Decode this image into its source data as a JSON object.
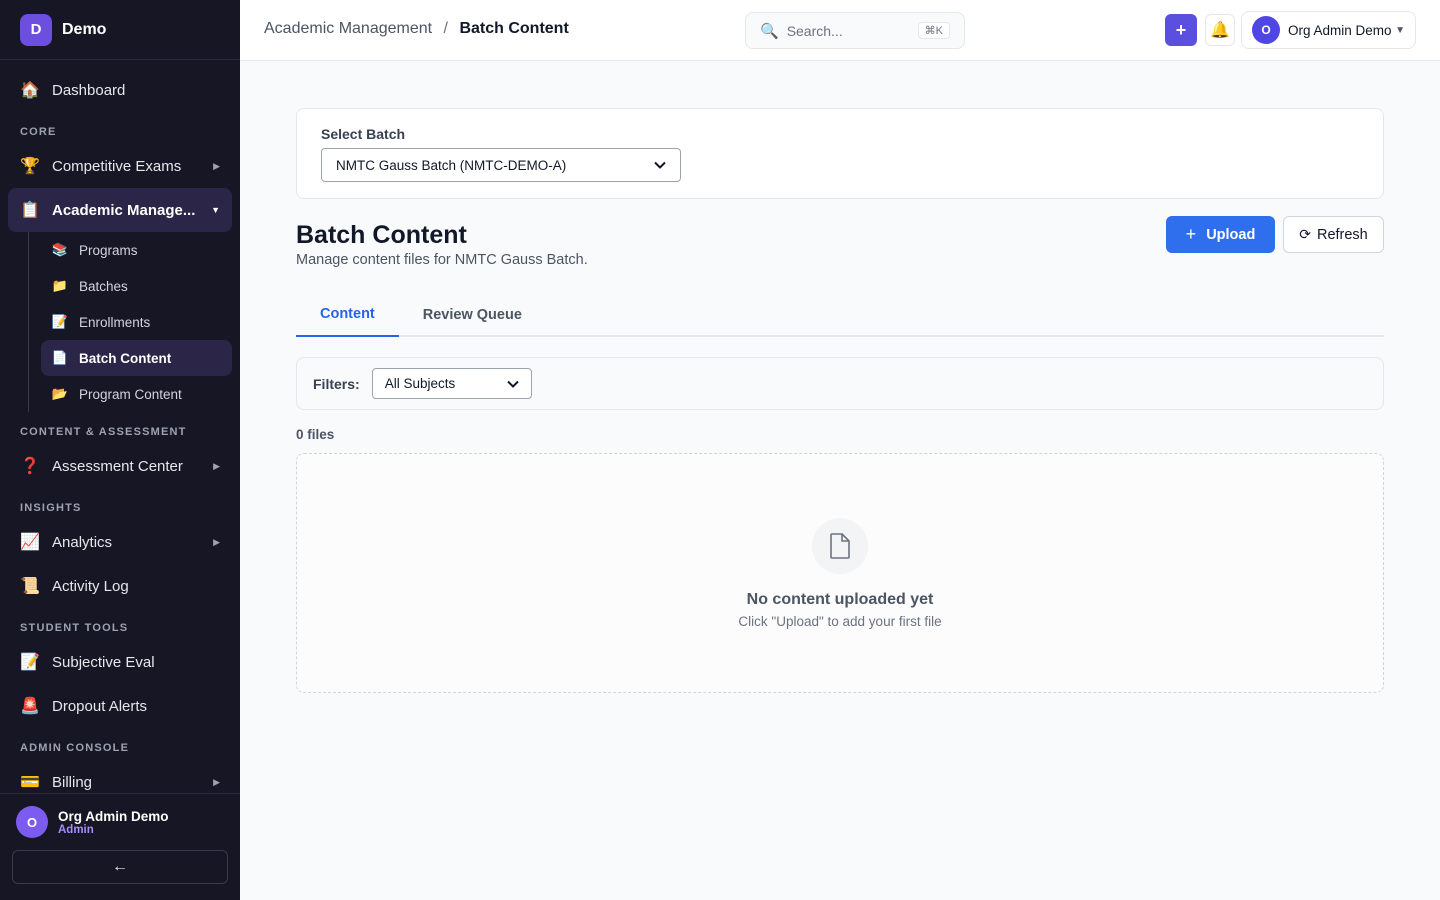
{
  "app": {
    "logo_letter": "D",
    "name": "Demo"
  },
  "sidebar": {
    "dashboard": {
      "icon": "🏠",
      "label": "Dashboard"
    },
    "sections": {
      "core": "CORE",
      "content_assessment": "CONTENT & ASSESSMENT",
      "insights": "INSIGHTS",
      "student_tools": "STUDENT TOOLS",
      "admin_console": "ADMIN CONSOLE"
    },
    "competitive_exams": {
      "icon": "🏆",
      "label": "Competitive Exams"
    },
    "academic_management": {
      "icon": "📋",
      "label": "Academic Manage..."
    },
    "sub_items": [
      {
        "icon": "📚",
        "label": "Programs"
      },
      {
        "icon": "📁",
        "label": "Batches"
      },
      {
        "icon": "📝",
        "label": "Enrollments"
      },
      {
        "icon": "📄",
        "label": "Batch Content"
      },
      {
        "icon": "📂",
        "label": "Program Content"
      }
    ],
    "assessment_center": {
      "icon": "❓",
      "label": "Assessment Center"
    },
    "analytics": {
      "icon": "📈",
      "label": "Analytics"
    },
    "activity_log": {
      "icon": "📜",
      "label": "Activity Log"
    },
    "subjective_eval": {
      "icon": "📝",
      "label": "Subjective Eval"
    },
    "dropout_alerts": {
      "icon": "🚨",
      "label": "Dropout Alerts"
    },
    "billing": {
      "icon": "💳",
      "label": "Billing"
    },
    "user": {
      "initial": "O",
      "name": "Org Admin Demo",
      "role": "Admin"
    },
    "collapse_label": "←"
  },
  "topbar": {
    "breadcrumb": {
      "parent": "Academic Management",
      "separator": "/",
      "current": "Batch Content"
    },
    "search": {
      "icon": "🔍",
      "placeholder": "Search...",
      "shortcut": "⌘K"
    },
    "plus_label": "+",
    "bell_icon": "🔔",
    "user": {
      "initial": "O",
      "name": "Org Admin Demo",
      "caret": "▼"
    }
  },
  "batch_selector": {
    "label": "Select Batch",
    "selected": "NMTC Gauss Batch (NMTC-DEMO-A)"
  },
  "page": {
    "title": "Batch Content",
    "subtitle": "Manage content files for NMTC Gauss Batch.",
    "upload_label": "Upload",
    "refresh_label": "Refresh"
  },
  "tabs": [
    {
      "label": "Content",
      "active": true
    },
    {
      "label": "Review Queue",
      "active": false
    }
  ],
  "filters": {
    "label": "Filters:",
    "subject_selected": "All Subjects"
  },
  "file_count": "0 files",
  "empty_state": {
    "title": "No content uploaded yet",
    "subtitle": "Click \"Upload\" to add your first file"
  },
  "colors": {
    "accent": "#5b4fe0",
    "primary_blue": "#2f6fed",
    "sidebar_bg": "#161625"
  }
}
